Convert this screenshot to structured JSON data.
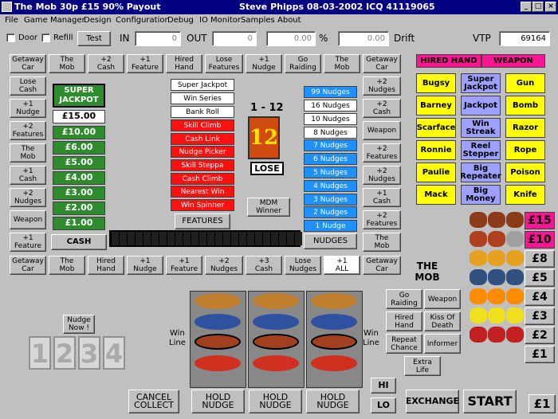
{
  "titlebar": {
    "title": "The Mob 30p £15 90% Payout",
    "author": "Steve Phipps 08-03-2002 ICQ 41119065",
    "min": "_",
    "max": "□",
    "close": "×"
  },
  "menu": [
    "File",
    "Game Manager",
    "Design",
    "Configuration",
    "Debug",
    "IO Monitor",
    "Samples",
    "About"
  ],
  "toolbar": {
    "door": "Door",
    "refill": "Refill",
    "test": "Test",
    "in_label": "IN",
    "in_value": "0",
    "out_label": "OUT",
    "out_value": "0",
    "percent_value": "0.00",
    "percent_sign": "%",
    "drift_value": "0.00",
    "drift_label": "Drift",
    "vtp_label": "VTP",
    "vtp_value": "69164"
  },
  "top_row": [
    "Getaway\nCar",
    "The\nMob",
    "+2\nCash",
    "+1\nFeature",
    "Hired\nHand",
    "Lose\nFeatures",
    "+1\nNudge",
    "Go\nRaiding",
    "The\nMob",
    "Getaway\nCar"
  ],
  "left_col": [
    "Lose\nCash",
    "+1\nNudge",
    "+2\nFeatures",
    "The\nMob",
    "+1\nCash",
    "+2\nNudges",
    "Weapon",
    "+1\nFeature"
  ],
  "right_col": [
    "+2\nNudges",
    "+2\nCash",
    "Weapon",
    "+2\nFeatures",
    "+2\nNudges",
    "+1\nCash",
    "+2\nFeatures",
    "The\nMob"
  ],
  "bottom_row": [
    "Getaway\nCar",
    "The\nMob",
    "Hired\nHand",
    "+1\nNudge",
    "+1\nFeature",
    "+2\nNudges",
    "+3\nCash",
    "Lose\nNudges",
    "+1\nALL",
    "Getaway\nCar"
  ],
  "jackpot": {
    "title": "SUPER\nJACKPOT",
    "amounts": [
      "£15.00",
      "£10.00",
      "£6.00",
      "£5.00",
      "£4.00",
      "£3.00",
      "£2.00",
      "£1.00"
    ],
    "cash_button": "CASH"
  },
  "features": {
    "items": [
      "Super Jackpot",
      "Win Series",
      "Bank Roll",
      "Skill Climb",
      "Cash Link",
      "Nudge Picker",
      "Skill Steppa",
      "Cash Climb",
      "Nearest Win",
      "Win Spinner"
    ],
    "button": "FEATURES"
  },
  "number_display": {
    "range": "1 - 12",
    "value": "12",
    "result": "LOSE",
    "mdm": "MDM\nWinner"
  },
  "nudges": {
    "items": [
      "99 Nudges",
      "16 Nudges",
      "10 Nudges",
      "8 Nudges",
      "7 Nudges",
      "6 Nudges",
      "5 Nudges",
      "4 Nudges",
      "3 Nudges",
      "2 Nudges",
      "1 Nudge"
    ],
    "button": "NUDGES"
  },
  "mob": {
    "hired_hand": "HIRED HAND",
    "weapon": "WEAPON",
    "grid": [
      [
        "Bugsy",
        "Super\nJackpot",
        "Gun"
      ],
      [
        "Barney",
        "Jackpot",
        "Bomb"
      ],
      [
        "Scarface",
        "Win\nStreak",
        "Razor"
      ],
      [
        "Ronnie",
        "Reel\nStepper",
        "Rope"
      ],
      [
        "Paulie",
        "Big\nRepeater",
        "Poison"
      ],
      [
        "Mack",
        "Big\nMoney",
        "Knife"
      ]
    ]
  },
  "paytable": [
    "£15",
    "£10",
    "£8",
    "£5",
    "£4",
    "£3",
    "£2",
    "£1"
  ],
  "mob_title": "THE\nMOB",
  "mob_feature_buttons": [
    "Go\nRaiding",
    "Weapon",
    "Hired\nHand",
    "Kiss Of\nDeath",
    "Repeat\nChance",
    "Informer",
    "Extra\nLife"
  ],
  "nudge_now": "Nudge\nNow !",
  "nudge_digits": [
    "1",
    "2",
    "3",
    "4"
  ],
  "win_line": "Win\nLine",
  "bottom_buttons": {
    "cancel": "CANCEL\nCOLLECT",
    "hold1": "HOLD\nNUDGE",
    "hold2": "HOLD\nNUDGE",
    "hold3": "HOLD\nNUDGE",
    "hi": "HI",
    "lo": "LO",
    "exchange": "EXCHANGE",
    "start": "START",
    "credit": "£1"
  },
  "colors": {
    "title": "#000080",
    "green": "#2e8b2e",
    "red": "#ff1010",
    "blue": "#1e90ff",
    "yellow": "#ffff00",
    "lavender": "#9da0ff",
    "pink": "#ff1493"
  }
}
